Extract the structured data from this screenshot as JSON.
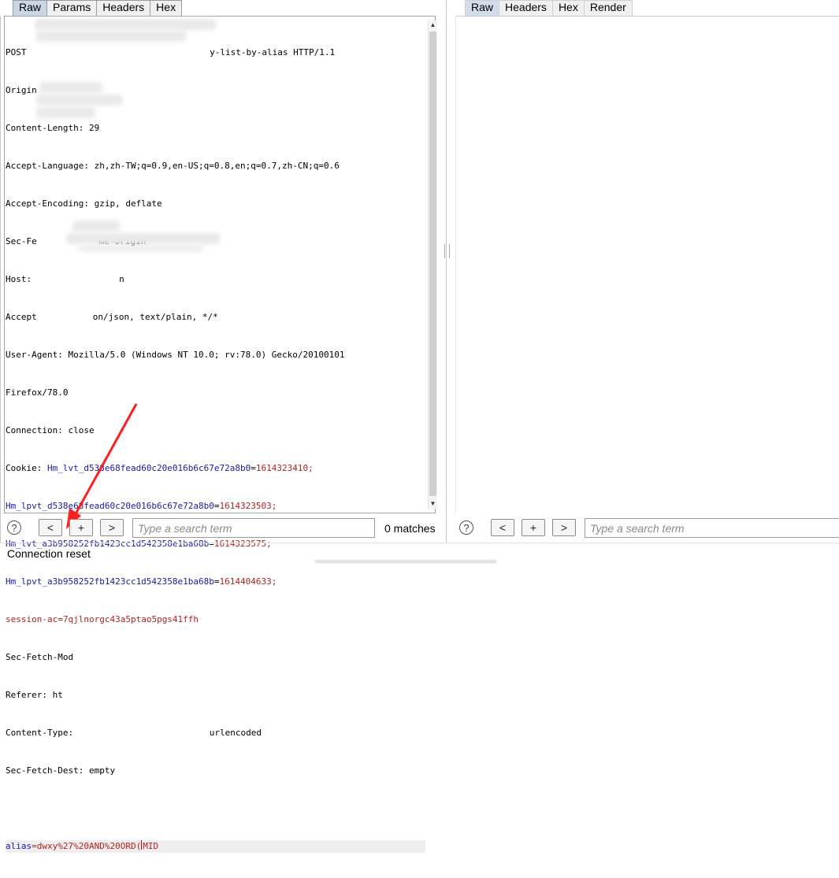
{
  "request_tabs": [
    "Raw",
    "Params",
    "Headers",
    "Hex"
  ],
  "response_tabs": [
    "Raw",
    "Headers",
    "Hex",
    "Render"
  ],
  "request_lines": {
    "l1": "POST ",
    "l1b": "y-list-by-alias HTTP/1.1",
    "l2": "Origin",
    "l3": "Content-Length: 29",
    "l4": "Accept-Language: zh,zh-TW;q=0.9,en-US;q=0.8,en;q=0.7,zh-CN;q=0.6",
    "l5": "Accept-Encoding: gzip, deflate",
    "l6a": "Sec-Fe",
    "l6b": "me-origin",
    "l7a": "Host:",
    "l7b": "n",
    "l8a": "Accept",
    "l8b": "on/json, text/plain, */*",
    "l9": "User-Agent: Mozilla/5.0 (Windows NT 10.0; rv:78.0) Gecko/20100101",
    "l10": "Firefox/78.0",
    "l11": "Connection: close",
    "cookie_label": "Cookie: ",
    "cookie1_k": "Hm_lvt_d538e68fead60c20e016b6c67e72a8b0",
    "cookie1_v": "1614323410;",
    "cookie2_k": "Hm_lpvt_d538e68fead60c20e016b6c67e72a8b0",
    "cookie2_v": "1614323503;",
    "cookie3_k": "Hm_lvt_a3b958252fb1423cc1d542358e1ba68b",
    "cookie3_v": "1614323575;",
    "cookie4_k": "Hm_lpvt_a3b958252fb1423cc1d542358e1ba68b",
    "cookie4_v": "1614404633;",
    "cookie5_k": "session-ac",
    "cookie5_v": "7qjlnorgc43a5ptao5pgs41ffh",
    "eq": "=",
    "l18": "Sec-Fetch-Mod",
    "l19": "Referer: ht",
    "l20a": "Content-Type: ",
    "l20b": "urlencoded",
    "l21": "Sec-Fetch-Dest: empty",
    "body_k": "alias",
    "body_v1": "dwxy%27%20AND%20ORD(",
    "body_v2": "MID"
  },
  "search": {
    "help": "?",
    "prev": "<",
    "add": "+",
    "next": ">",
    "placeholder": "Type a search term",
    "matches": "0 matches"
  },
  "status": "Connection reset",
  "colors": {
    "header_name": "#1a1aa6",
    "header_value": "#b22222",
    "arrow": "#ff1f1f",
    "active_tab": "#c9d6e6"
  }
}
